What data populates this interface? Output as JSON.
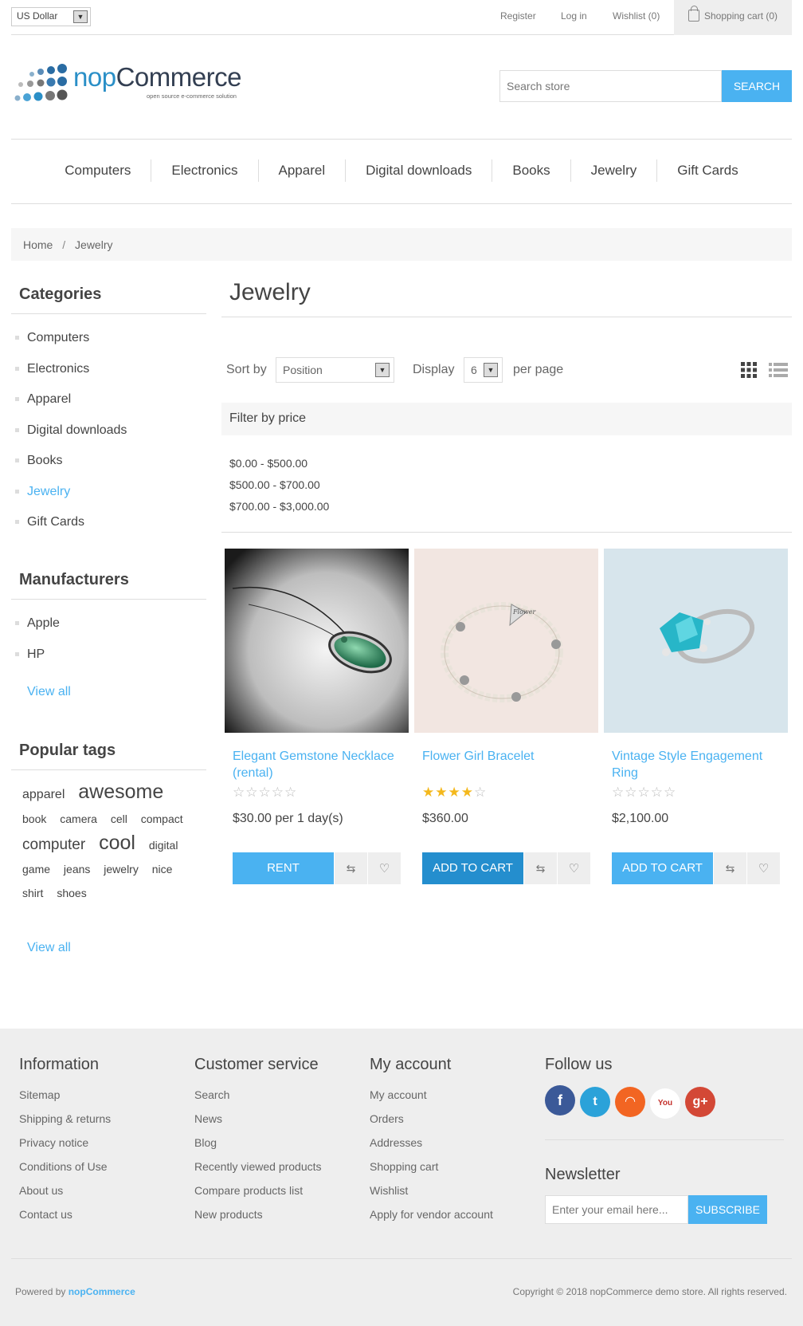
{
  "header": {
    "currency": "US Dollar",
    "links": {
      "register": "Register",
      "login": "Log in",
      "wishlist": "Wishlist (0)",
      "cart": "Shopping cart (0)"
    }
  },
  "logo": {
    "brand_light": "nop",
    "brand_dark": "Commerce",
    "tagline": "open source e-commerce solution"
  },
  "search": {
    "placeholder": "Search store",
    "button": "SEARCH"
  },
  "top_menu": [
    "Computers",
    "Electronics",
    "Apparel",
    "Digital downloads",
    "Books",
    "Jewelry",
    "Gift Cards"
  ],
  "breadcrumb": {
    "home": "Home",
    "separator": "/",
    "current": "Jewelry"
  },
  "sidebar": {
    "categories_title": "Categories",
    "categories": [
      "Computers",
      "Electronics",
      "Apparel",
      "Digital downloads",
      "Books",
      "Jewelry",
      "Gift Cards"
    ],
    "active_category": "Jewelry",
    "manufacturers_title": "Manufacturers",
    "manufacturers": [
      "Apple",
      "HP"
    ],
    "view_all": "View all",
    "tags_title": "Popular tags",
    "tags": [
      "apparel",
      "awesome",
      "book",
      "camera",
      "cell",
      "compact",
      "computer",
      "cool",
      "digital",
      "game",
      "jeans",
      "jewelry",
      "nice",
      "shirt",
      "shoes"
    ]
  },
  "main": {
    "title": "Jewelry",
    "sort_label": "Sort by",
    "sort_value": "Position",
    "display_label": "Display",
    "display_value": "6",
    "per_page": "per page",
    "filter_title": "Filter by price",
    "price_ranges": [
      "$0.00 - $500.00",
      "$500.00 - $700.00",
      "$700.00 - $3,000.00"
    ]
  },
  "products": [
    {
      "name": "Elegant Gemstone Necklace (rental)",
      "rating": 0,
      "price": "$30.00 per 1 day(s)",
      "button": "RENT"
    },
    {
      "name": "Flower Girl Bracelet",
      "rating": 4,
      "price": "$360.00",
      "button": "ADD TO CART"
    },
    {
      "name": "Vintage Style Engagement Ring",
      "rating": 0,
      "price": "$2,100.00",
      "button": "ADD TO CART"
    }
  ],
  "footer": {
    "information": {
      "title": "Information",
      "items": [
        "Sitemap",
        "Shipping & returns",
        "Privacy notice",
        "Conditions of Use",
        "About us",
        "Contact us"
      ]
    },
    "customer_service": {
      "title": "Customer service",
      "items": [
        "Search",
        "News",
        "Blog",
        "Recently viewed products",
        "Compare products list",
        "New products"
      ]
    },
    "my_account": {
      "title": "My account",
      "items": [
        "My account",
        "Orders",
        "Addresses",
        "Shopping cart",
        "Wishlist",
        "Apply for vendor account"
      ]
    },
    "follow_us": "Follow us",
    "social_icons": [
      "facebook-icon",
      "twitter-icon",
      "rss-icon",
      "youtube-icon",
      "google-plus-icon"
    ],
    "newsletter_title": "Newsletter",
    "newsletter_placeholder": "Enter your email here...",
    "subscribe": "SUBSCRIBE",
    "powered_by": "Powered by",
    "powered_brand": "nopCommerce",
    "copyright": "Copyright © 2018 nopCommerce demo store. All rights reserved."
  },
  "colors": {
    "accent": "#4ab2f1",
    "accent_dark": "#248ece",
    "star": "#f4b81c"
  }
}
